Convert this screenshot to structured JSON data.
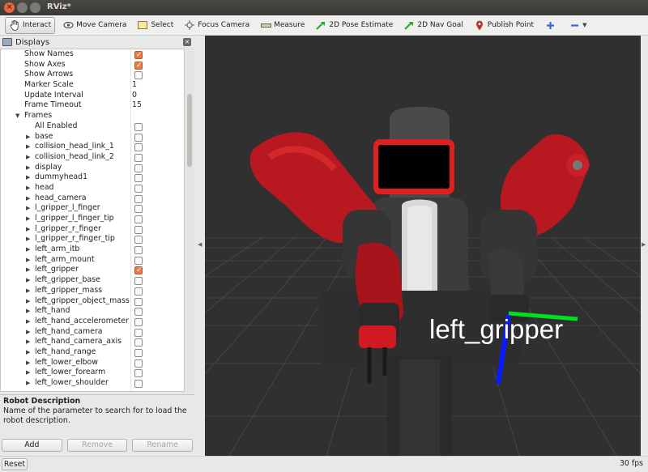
{
  "window": {
    "title": "RViz*"
  },
  "toolbar": {
    "tools": [
      {
        "label": "Interact",
        "icon": "hand-icon"
      },
      {
        "label": "Move Camera",
        "icon": "move-camera-icon"
      },
      {
        "label": "Select",
        "icon": "select-icon"
      },
      {
        "label": "Focus Camera",
        "icon": "focus-camera-icon"
      },
      {
        "label": "Measure",
        "icon": "ruler-icon"
      },
      {
        "label": "2D Pose Estimate",
        "icon": "green-arrow-icon"
      },
      {
        "label": "2D Nav Goal",
        "icon": "green-arrow-icon"
      },
      {
        "label": "Publish Point",
        "icon": "map-pin-icon"
      }
    ]
  },
  "displays": {
    "title": "Displays",
    "rows": [
      {
        "label": "Show Names",
        "indent": 2,
        "checkbox": true,
        "checked": true
      },
      {
        "label": "Show Axes",
        "indent": 2,
        "checkbox": true,
        "checked": true
      },
      {
        "label": "Show Arrows",
        "indent": 2,
        "checkbox": true,
        "checked": false
      },
      {
        "label": "Marker Scale",
        "indent": 2,
        "value": "1"
      },
      {
        "label": "Update Interval",
        "indent": 2,
        "value": "0"
      },
      {
        "label": "Frame Timeout",
        "indent": 2,
        "value": "15"
      },
      {
        "label": "Frames",
        "indent": 2,
        "expander": "open"
      },
      {
        "label": "All Enabled",
        "indent": 3,
        "checkbox": true,
        "checked": false
      },
      {
        "label": "base",
        "indent": 3,
        "expander": "closed",
        "checkbox": true,
        "checked": false
      },
      {
        "label": "collision_head_link_1",
        "indent": 3,
        "expander": "closed",
        "checkbox": true,
        "checked": false
      },
      {
        "label": "collision_head_link_2",
        "indent": 3,
        "expander": "closed",
        "checkbox": true,
        "checked": false
      },
      {
        "label": "display",
        "indent": 3,
        "expander": "closed",
        "checkbox": true,
        "checked": false
      },
      {
        "label": "dummyhead1",
        "indent": 3,
        "expander": "closed",
        "checkbox": true,
        "checked": false
      },
      {
        "label": "head",
        "indent": 3,
        "expander": "closed",
        "checkbox": true,
        "checked": false
      },
      {
        "label": "head_camera",
        "indent": 3,
        "expander": "closed",
        "checkbox": true,
        "checked": false
      },
      {
        "label": "l_gripper_l_finger",
        "indent": 3,
        "expander": "closed",
        "checkbox": true,
        "checked": false
      },
      {
        "label": "l_gripper_l_finger_tip",
        "indent": 3,
        "expander": "closed",
        "checkbox": true,
        "checked": false
      },
      {
        "label": "l_gripper_r_finger",
        "indent": 3,
        "expander": "closed",
        "checkbox": true,
        "checked": false
      },
      {
        "label": "l_gripper_r_finger_tip",
        "indent": 3,
        "expander": "closed",
        "checkbox": true,
        "checked": false
      },
      {
        "label": "left_arm_itb",
        "indent": 3,
        "expander": "closed",
        "checkbox": true,
        "checked": false
      },
      {
        "label": "left_arm_mount",
        "indent": 3,
        "expander": "closed",
        "checkbox": true,
        "checked": false
      },
      {
        "label": "left_gripper",
        "indent": 3,
        "expander": "closed",
        "checkbox": true,
        "checked": true
      },
      {
        "label": "left_gripper_base",
        "indent": 3,
        "expander": "closed",
        "checkbox": true,
        "checked": false
      },
      {
        "label": "left_gripper_mass",
        "indent": 3,
        "expander": "closed",
        "checkbox": true,
        "checked": false
      },
      {
        "label": "left_gripper_object_mass",
        "indent": 3,
        "expander": "closed",
        "checkbox": true,
        "checked": false
      },
      {
        "label": "left_hand",
        "indent": 3,
        "expander": "closed",
        "checkbox": true,
        "checked": false
      },
      {
        "label": "left_hand_accelerometer",
        "indent": 3,
        "expander": "closed",
        "checkbox": true,
        "checked": false
      },
      {
        "label": "left_hand_camera",
        "indent": 3,
        "expander": "closed",
        "checkbox": true,
        "checked": false
      },
      {
        "label": "left_hand_camera_axis",
        "indent": 3,
        "expander": "closed",
        "checkbox": true,
        "checked": false
      },
      {
        "label": "left_hand_range",
        "indent": 3,
        "expander": "closed",
        "checkbox": true,
        "checked": false
      },
      {
        "label": "left_lower_elbow",
        "indent": 3,
        "expander": "closed",
        "checkbox": true,
        "checked": false
      },
      {
        "label": "left_lower_forearm",
        "indent": 3,
        "expander": "closed",
        "checkbox": true,
        "checked": false
      },
      {
        "label": "left_lower_shoulder",
        "indent": 3,
        "expander": "closed",
        "checkbox": true,
        "checked": false
      }
    ]
  },
  "description": {
    "title": "Robot Description",
    "text": "Name of the parameter to search for to load the robot description."
  },
  "buttons": {
    "add": "Add",
    "remove": "Remove",
    "rename": "Rename"
  },
  "status": {
    "reset": "Reset",
    "fps": "30 fps"
  },
  "viewport": {
    "frame_label": "left_gripper"
  },
  "colors": {
    "robot_red": "#c0121a",
    "robot_dark": "#3a3a3a",
    "axis_green": "#00e020",
    "axis_blue": "#0a1aff",
    "background": "#303030",
    "checkbox_on": "#e87a4a"
  }
}
